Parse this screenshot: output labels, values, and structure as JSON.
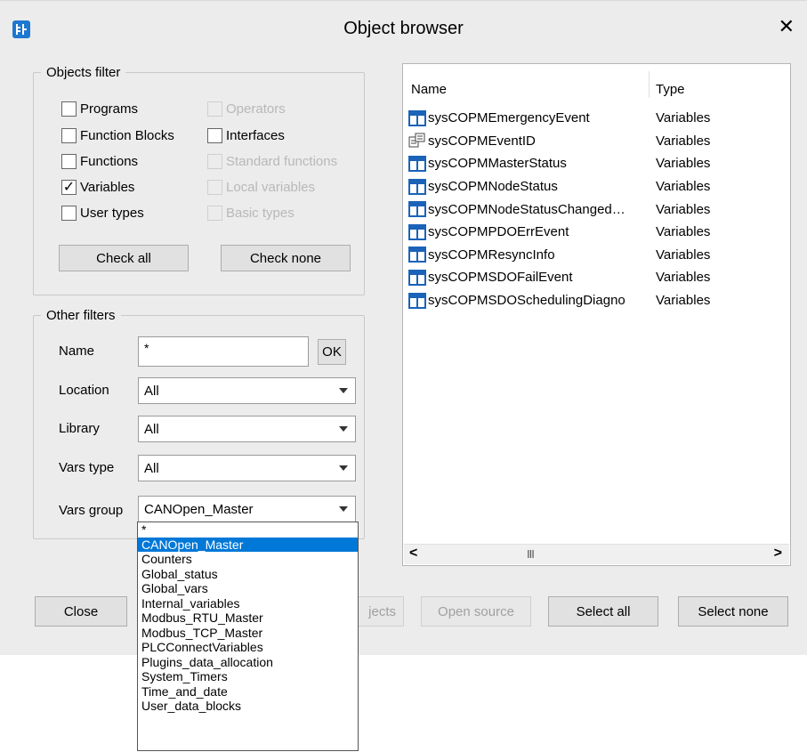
{
  "window": {
    "title": "Object browser",
    "close_glyph": "✕"
  },
  "objects_filter": {
    "legend": "Objects filter",
    "checkboxes_left": [
      {
        "label": "Programs",
        "checked": false
      },
      {
        "label": "Function Blocks",
        "checked": false
      },
      {
        "label": "Functions",
        "checked": false
      },
      {
        "label": "Variables",
        "checked": true
      },
      {
        "label": "User types",
        "checked": false
      }
    ],
    "checkboxes_right": [
      {
        "label": "Operators",
        "enabled": false
      },
      {
        "label": "Interfaces",
        "enabled": true
      },
      {
        "label": "Standard functions",
        "enabled": false
      },
      {
        "label": "Local variables",
        "enabled": false
      },
      {
        "label": "Basic types",
        "enabled": false
      }
    ],
    "check_all_label": "Check all",
    "check_none_label": "Check none"
  },
  "other_filters": {
    "legend": "Other filters",
    "name_label": "Name",
    "name_value": "*",
    "ok_label": "OK",
    "location_label": "Location",
    "location_value": "All",
    "library_label": "Library",
    "library_value": "All",
    "vars_type_label": "Vars type",
    "vars_type_value": "All",
    "vars_group_label": "Vars group",
    "vars_group_value": "CANOpen_Master"
  },
  "dropdown_options": [
    "*",
    "CANOpen_Master",
    "Counters",
    "Global_status",
    "Global_vars",
    "Internal_variables",
    "Modbus_RTU_Master",
    "Modbus_TCP_Master",
    "PLCConnectVariables",
    "Plugins_data_allocation",
    "System_Timers",
    "Time_and_date",
    "User_data_blocks"
  ],
  "dropdown_selected_index": 1,
  "results": {
    "columns": [
      "Name",
      "Type"
    ],
    "rows": [
      {
        "icon": "variable-icon",
        "name": "sysCOPMEmergencyEvent",
        "type": "Variables"
      },
      {
        "icon": "reference-icon",
        "name": "sysCOPMEventID",
        "type": "Variables"
      },
      {
        "icon": "variable-icon",
        "name": "sysCOPMMasterStatus",
        "type": "Variables"
      },
      {
        "icon": "variable-icon",
        "name": "sysCOPMNodeStatus",
        "type": "Variables"
      },
      {
        "icon": "variable-icon",
        "name": "sysCOPMNodeStatusChanged…",
        "type": "Variables"
      },
      {
        "icon": "variable-icon",
        "name": "sysCOPMPDOErrEvent",
        "type": "Variables"
      },
      {
        "icon": "variable-icon",
        "name": "sysCOPMResyncInfo",
        "type": "Variables"
      },
      {
        "icon": "variable-icon",
        "name": "sysCOPMSDOFailEvent",
        "type": "Variables"
      },
      {
        "icon": "variable-icon",
        "name": "sysCOPMSDOSchedulingDiagno",
        "type": "Variables"
      }
    ],
    "scroll_left": "<",
    "scroll_right": ">",
    "scroll_thumb": "III"
  },
  "bottom_buttons": {
    "close": "Close",
    "objects_partial": "jects",
    "open_source": "Open source",
    "select_all": "Select all",
    "select_none": "Select none"
  },
  "colors": {
    "accent": "#0078d7",
    "icon_blue": "#1a63b8",
    "dialog_bg": "#ececec"
  }
}
